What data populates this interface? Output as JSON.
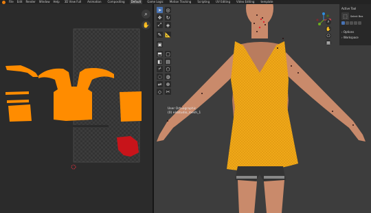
{
  "menu": {
    "items": [
      "File",
      "Edit",
      "Render",
      "Window",
      "Help"
    ],
    "workspaces": [
      "3D View Full",
      "Animation",
      "Compositing",
      "Default",
      "Game Logic",
      "Motion Tracking",
      "Scripting",
      "UV Editing",
      "Video Editing",
      "template"
    ],
    "active_workspace": "Default"
  },
  "uv_editor": {
    "nav_icons": [
      "zoom-icon",
      "hand-icon"
    ]
  },
  "viewport": {
    "view_label": "User Orthographic",
    "object_label": "(0) eldstudio_mesh_1"
  },
  "npanel": {
    "header": "Active Tool",
    "tool_name": "Select Box",
    "options_label": "Options",
    "workspace_label": "Workspace"
  },
  "colors": {
    "uv_island": "#ff8c00",
    "dress": "#f0a818",
    "skin": "#c98a6b",
    "accent": "#4772b3"
  }
}
